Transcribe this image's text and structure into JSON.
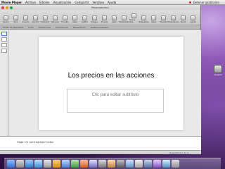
{
  "menubar": {
    "app_name": "Movie Player",
    "items": [
      "Archivo",
      "Edición",
      "Visualización",
      "Compartir",
      "Ventana",
      "Ayuda"
    ],
    "recording_label": "Detener grabación"
  },
  "window": {
    "title": "Presentación1",
    "toolbar_buttons": [
      "Nuevo",
      "Abrir",
      "Guardar",
      "Imprimir",
      "Deshacer",
      "Rehacer",
      "Formato",
      "Tabla",
      "Gráfico",
      "Imagen",
      "Formas",
      "Texto",
      "Multimedia",
      "Nueva diap.",
      "Diapositiva",
      "Tema",
      "Mostrar",
      "Presentación",
      "Zoom",
      "Ayuda"
    ],
    "ribbon_tabs": [
      "Temas de diapositiva",
      "Inicio",
      "Transiciones",
      "Animaciones",
      "Presentación",
      "Gráficos SmartArt"
    ],
    "slide": {
      "title": "Los precios en las acciones",
      "subtitle_placeholder": "Clic para editar subtítulo"
    },
    "notes_placeholder": "Haga clic para agregar notas",
    "status": "Diapositiva 1 de 4"
  },
  "desktop_icon": {
    "label": "plugins"
  },
  "colors": {
    "accent": "#3b7bd6",
    "desktop": "#5a2f7e"
  }
}
